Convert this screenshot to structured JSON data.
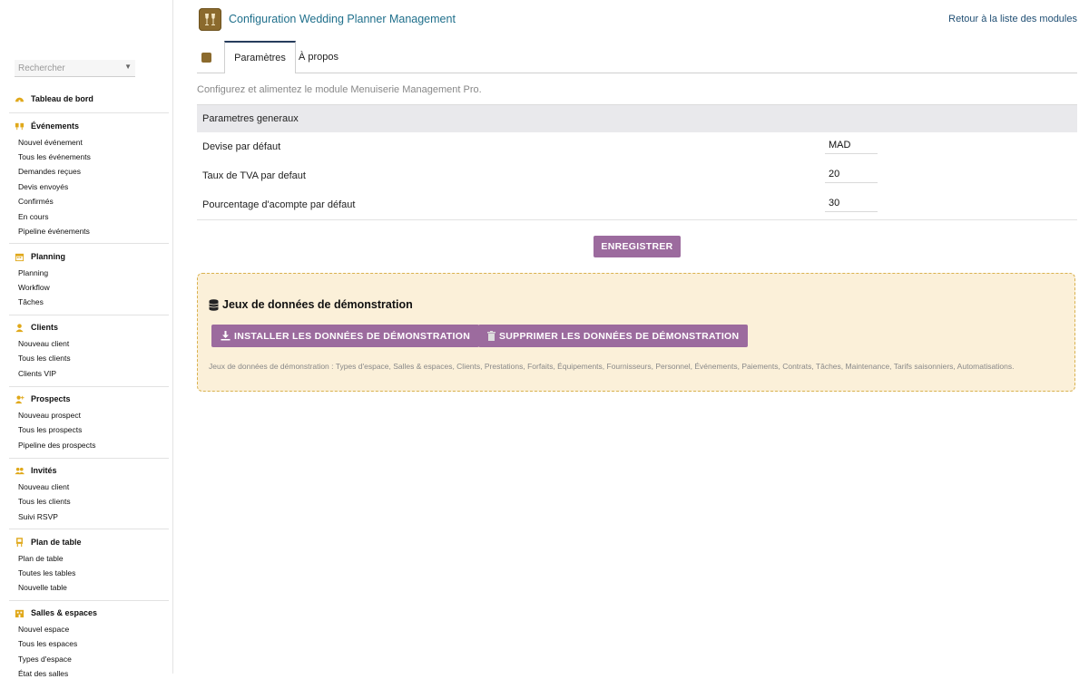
{
  "header": {
    "app_title": "Configuration Wedding Planner Management",
    "back_link": "Retour à la liste des modules"
  },
  "sidebar": {
    "search_placeholder": "Rechercher",
    "dashboard": "Tableau de bord",
    "sections": [
      {
        "title": "Événements",
        "icon": "glasses-icon",
        "items": [
          "Nouvel événement",
          "Tous les événements",
          "Demandes reçues",
          "Devis envoyés",
          "Confirmés",
          "En cours",
          "Pipeline événements"
        ]
      },
      {
        "title": "Planning",
        "icon": "calendar-icon",
        "items": [
          "Planning",
          "Workflow",
          "Tâches"
        ]
      },
      {
        "title": "Clients",
        "icon": "user-icon",
        "items": [
          "Nouveau client",
          "Tous les clients",
          "Clients VIP"
        ]
      },
      {
        "title": "Prospects",
        "icon": "user-plus-icon",
        "items": [
          "Nouveau prospect",
          "Tous les prospects",
          "Pipeline des prospects"
        ]
      },
      {
        "title": "Invités",
        "icon": "users-icon",
        "items": [
          "Nouveau client",
          "Tous les clients",
          "Suivi RSVP"
        ]
      },
      {
        "title": "Plan de table",
        "icon": "chair-icon",
        "items": [
          "Plan de table",
          "Toutes les tables",
          "Nouvelle table"
        ]
      },
      {
        "title": "Salles & espaces",
        "icon": "building-icon",
        "items": [
          "Nouvel espace",
          "Tous les espaces",
          "Types d'espace",
          "État des salles"
        ]
      }
    ]
  },
  "tabs": {
    "parametres": "Paramètres",
    "apropos": "À propos"
  },
  "main": {
    "intro": "Configurez et alimentez le module Menuiserie Management Pro.",
    "params_header": "Parametres generaux",
    "params": [
      {
        "label": "Devise par défaut",
        "value": "MAD"
      },
      {
        "label": "Taux de TVA par defaut",
        "value": "20"
      },
      {
        "label": "Pourcentage d'acompte par défaut",
        "value": "30"
      }
    ],
    "save_label": "ENREGISTRER"
  },
  "demo": {
    "title": "Jeux de données de démonstration",
    "install_label": "INSTALLER LES DONNÉES DE DÉMONSTRATION",
    "delete_label": "SUPPRIMER LES DONNÉES DE DÉMONSTRATION",
    "note": "Jeux de données de démonstration : Types d'espace, Salles & espaces, Clients, Prestations, Forfaits, Équipements, Fournisseurs, Personnel, Événements, Paiements, Contrats, Tâches, Maintenance, Tarifs saisonniers, Automatisations."
  },
  "colors": {
    "accent": "#9c6b9e",
    "title_teal": "#1f6f8b",
    "demo_bg": "#fbf0d9",
    "demo_border": "#d9b14e",
    "icon_gold": "#e0a81a"
  }
}
